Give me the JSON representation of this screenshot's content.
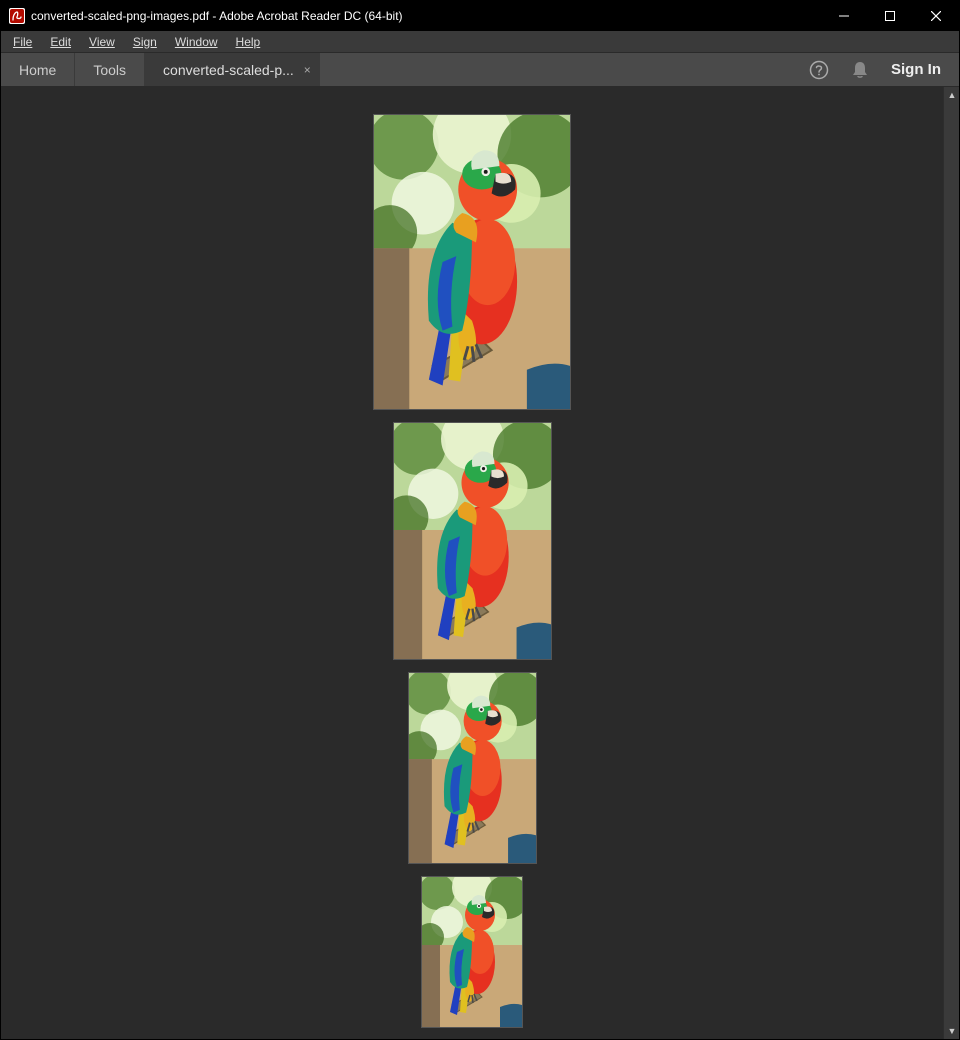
{
  "window": {
    "title": "converted-scaled-png-images.pdf - Adobe Acrobat Reader DC (64-bit)"
  },
  "menu": {
    "file": "File",
    "edit": "Edit",
    "view": "View",
    "sign": "Sign",
    "window": "Window",
    "help": "Help"
  },
  "tabs": {
    "home": "Home",
    "tools": "Tools",
    "document": "converted-scaled-p...",
    "close_glyph": "×"
  },
  "toolbar": {
    "signin": "Sign In"
  },
  "document": {
    "pages": [
      {
        "label": "page-1",
        "content": "parrot-image-100pct"
      },
      {
        "label": "page-2",
        "content": "parrot-image-80pct"
      },
      {
        "label": "page-3",
        "content": "parrot-image-64pct"
      },
      {
        "label": "page-4",
        "content": "parrot-image-51pct"
      }
    ]
  },
  "scroll": {
    "up_glyph": "▲",
    "down_glyph": "▼"
  }
}
